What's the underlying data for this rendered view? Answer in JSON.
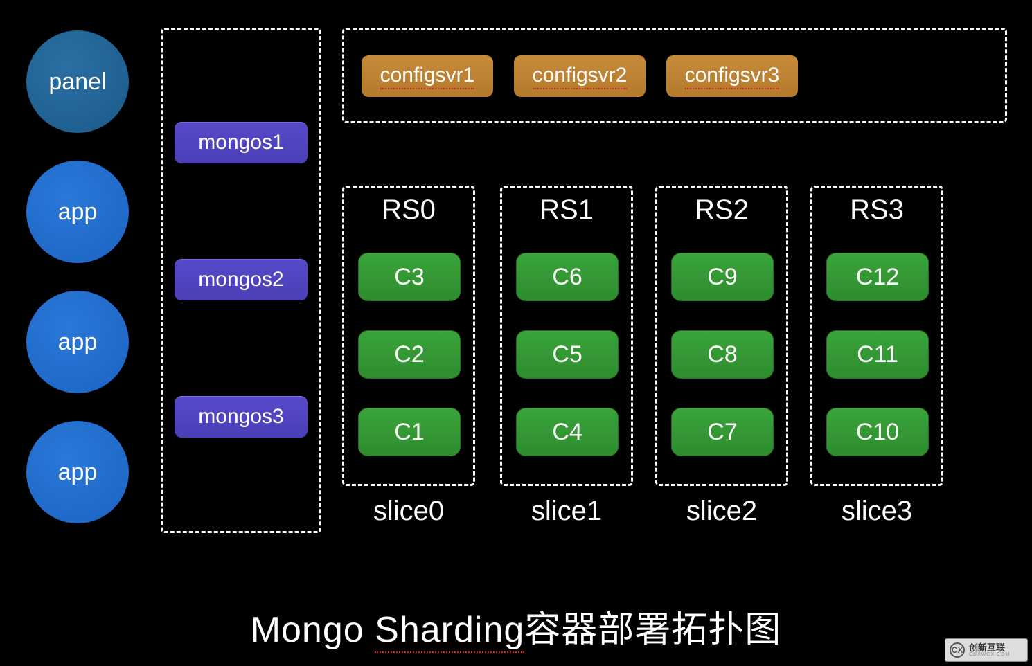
{
  "circles": {
    "panel": "panel",
    "app1": "app",
    "app2": "app",
    "app3": "app"
  },
  "mongos": {
    "m1": "mongos1",
    "m2": "mongos2",
    "m3": "mongos3"
  },
  "configsvr": {
    "c1": "configsvr1",
    "c2": "configsvr2",
    "c3": "configsvr3"
  },
  "rs": {
    "rs0": {
      "title": "RS0",
      "n1": "C3",
      "n2": "C2",
      "n3": "C1",
      "slice": "slice0"
    },
    "rs1": {
      "title": "RS1",
      "n1": "C6",
      "n2": "C5",
      "n3": "C4",
      "slice": "slice1"
    },
    "rs2": {
      "title": "RS2",
      "n1": "C9",
      "n2": "C8",
      "n3": "C7",
      "slice": "slice2"
    },
    "rs3": {
      "title": "RS3",
      "n1": "C12",
      "n2": "C11",
      "n3": "C10",
      "slice": "slice3"
    }
  },
  "title": {
    "pre": "Mongo ",
    "underlined": "Sharding",
    "post": "容器部署拓扑图"
  },
  "watermark": {
    "logo": "CX",
    "main": "创新互联",
    "sub": "CDXWCX.COM"
  }
}
